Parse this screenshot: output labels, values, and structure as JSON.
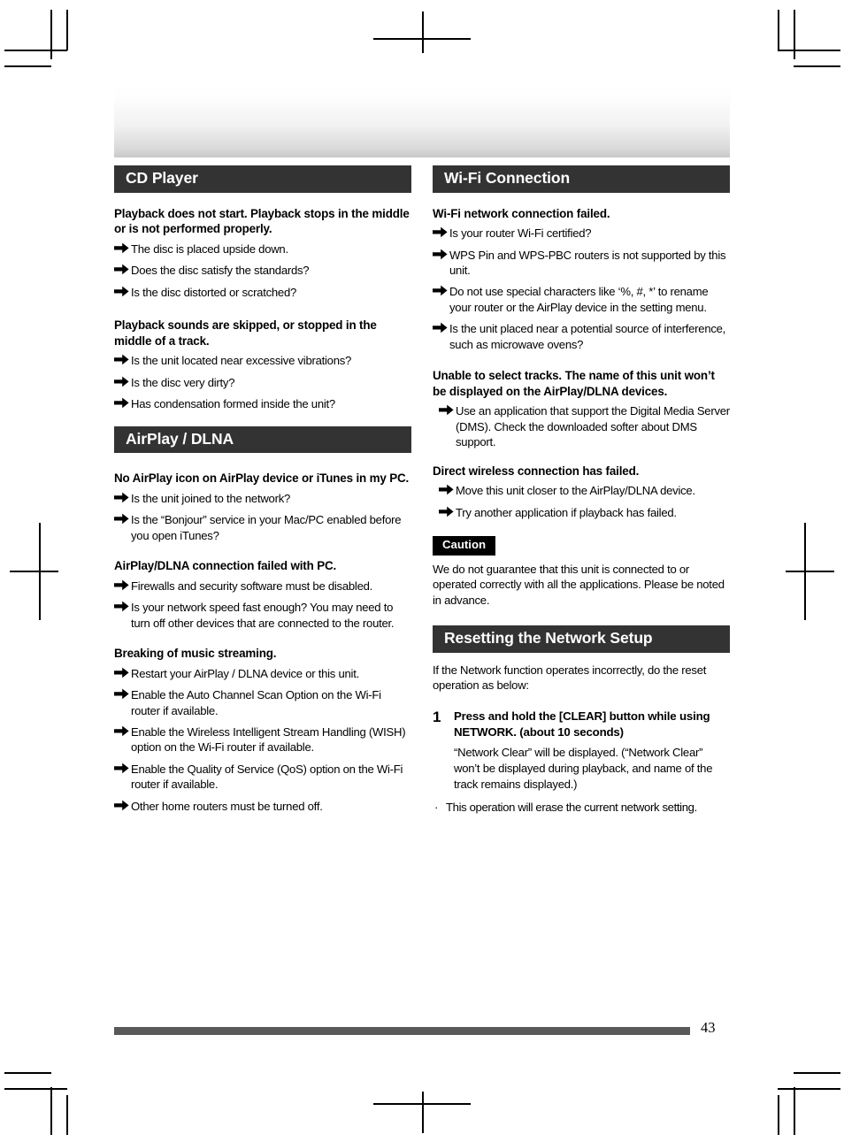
{
  "page": {
    "number": "43"
  },
  "left_column": {
    "sections": [
      {
        "title": "CD Player",
        "blocks": [
          {
            "question": "Playback does not start. Playback stops in the middle or is not performed properly.",
            "items": [
              "The disc is placed upside down.",
              "Does the disc satisfy the standards?",
              "Is the disc distorted or scratched?"
            ]
          },
          {
            "question": "Playback sounds are skipped, or stopped in the middle of a track.",
            "items": [
              "Is the unit located near excessive vibrations?",
              "Is the disc very dirty?",
              "Has condensation formed inside the unit?"
            ]
          }
        ]
      },
      {
        "title": "AirPlay / DLNA",
        "blocks": [
          {
            "question": "No AirPlay icon on AirPlay device or iTunes in my PC.",
            "items": [
              "Is the unit joined to the network?",
              "Is the “Bonjour” service in your Mac/PC enabled before you open iTunes?"
            ]
          },
          {
            "question": "AirPlay/DLNA connection failed with PC.",
            "items": [
              "Firewalls and security software must be disabled.",
              "Is your network speed fast enough? You may need to turn off other devices that are connected to the router."
            ]
          },
          {
            "question": "Breaking of music streaming.",
            "items": [
              "Restart your AirPlay / DLNA device or this unit.",
              "Enable the Auto Channel Scan Option on the Wi-Fi router if available.",
              "Enable the Wireless Intelligent Stream Handling (WISH) option on the Wi-Fi router if available.",
              "Enable the Quality of Service (QoS) option on the Wi-Fi router if available.",
              "Other home routers must be turned off."
            ]
          }
        ]
      }
    ]
  },
  "right_column": {
    "wifi_section": {
      "title": "Wi-Fi Connection",
      "blocks": [
        {
          "question": "Wi-Fi network connection failed.",
          "items": [
            "Is your router Wi-Fi certified?",
            "WPS Pin and WPS-PBC routers is not supported by this unit.",
            "Do not use special characters like ‘%, #, *’ to rename your router or the AirPlay device in the setting menu.",
            "Is the unit placed near a potential source of interference, such as microwave ovens?"
          ]
        },
        {
          "question": "Unable to select tracks. The name of this unit won’t be displayed on the AirPlay/DLNA devices.",
          "indented": true,
          "items": [
            "Use an application that support the Digital Media Server (DMS). Check the downloaded softer about DMS support."
          ]
        },
        {
          "question": "Direct wireless connection has failed.",
          "indented": true,
          "items": [
            "Move this unit closer to the AirPlay/DLNA device.",
            "Try another application if playback has failed."
          ]
        }
      ]
    },
    "caution": {
      "tag": "Caution",
      "body": "We do not guarantee that this unit is connected to or operated correctly with all the applications. Please be noted in advance."
    },
    "reset_section": {
      "title": "Resetting the Network Setup",
      "intro": "If the Network function operates incorrectly, do the reset operation as below:",
      "step": {
        "number": "1",
        "title": "Press and hold the [CLEAR] button while using NETWORK. (about 10 seconds)",
        "detail": "“Network Clear” will be displayed. (“Network Clear” won’t be displayed during playback, and name of the track remains displayed.)"
      },
      "note": {
        "bullet": "·",
        "text": "This operation will erase the current network setting."
      }
    }
  }
}
